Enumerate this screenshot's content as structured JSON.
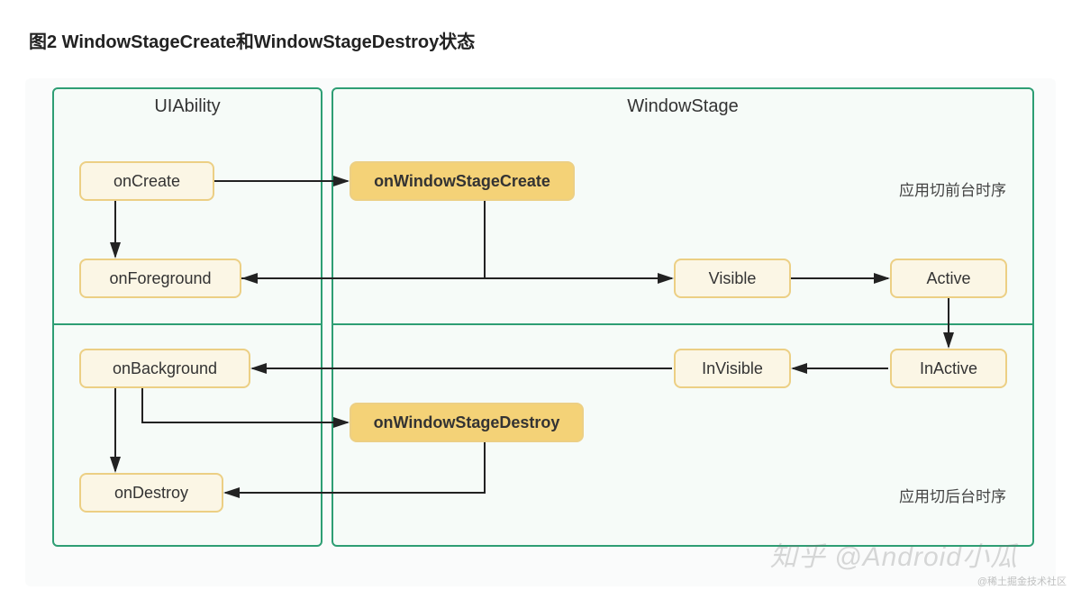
{
  "title": "图2 WindowStageCreate和WindowStageDestroy状态",
  "panels": {
    "uiability": {
      "label": "UIAbility"
    },
    "windowstage": {
      "label": "WindowStage"
    }
  },
  "nodes": {
    "onCreate": "onCreate",
    "onWindowStageCreate": "onWindowStageCreate",
    "onForeground": "onForeground",
    "visible": "Visible",
    "active": "Active",
    "onBackground": "onBackground",
    "invisible": "InVisible",
    "inactive": "InActive",
    "onWindowStageDestroy": "onWindowStageDestroy",
    "onDestroy": "onDestroy"
  },
  "annotations": {
    "foreground_seq": "应用切前台时序",
    "background_seq": "应用切后台时序"
  },
  "watermark": {
    "main": "知乎 @Android小瓜",
    "small": "@稀土掘金技术社区"
  },
  "chart_data": {
    "type": "diagram",
    "title": "WindowStageCreate和WindowStageDestroy状态",
    "groups": [
      {
        "id": "UIAbility",
        "nodes": [
          "onCreate",
          "onForeground",
          "onBackground",
          "onDestroy"
        ]
      },
      {
        "id": "WindowStage",
        "nodes": [
          "onWindowStageCreate",
          "Visible",
          "Active",
          "InVisible",
          "InActive",
          "onWindowStageDestroy"
        ]
      }
    ],
    "highlighted_nodes": [
      "onWindowStageCreate",
      "onWindowStageDestroy"
    ],
    "edges": [
      {
        "from": "onCreate",
        "to": "onWindowStageCreate"
      },
      {
        "from": "onWindowStageCreate",
        "to": "onForeground"
      },
      {
        "from": "onForeground",
        "to": "Visible"
      },
      {
        "from": "Visible",
        "to": "Active"
      },
      {
        "from": "Active",
        "to": "InActive"
      },
      {
        "from": "InActive",
        "to": "InVisible"
      },
      {
        "from": "InVisible",
        "to": "onBackground"
      },
      {
        "from": "onBackground",
        "to": "onWindowStageDestroy"
      },
      {
        "from": "onWindowStageDestroy",
        "to": "onDestroy"
      }
    ],
    "sections": [
      {
        "label": "应用切前台时序",
        "nodes": [
          "onCreate",
          "onWindowStageCreate",
          "onForeground",
          "Visible",
          "Active"
        ]
      },
      {
        "label": "应用切后台时序",
        "nodes": [
          "InActive",
          "InVisible",
          "onBackground",
          "onWindowStageDestroy",
          "onDestroy"
        ]
      }
    ]
  }
}
